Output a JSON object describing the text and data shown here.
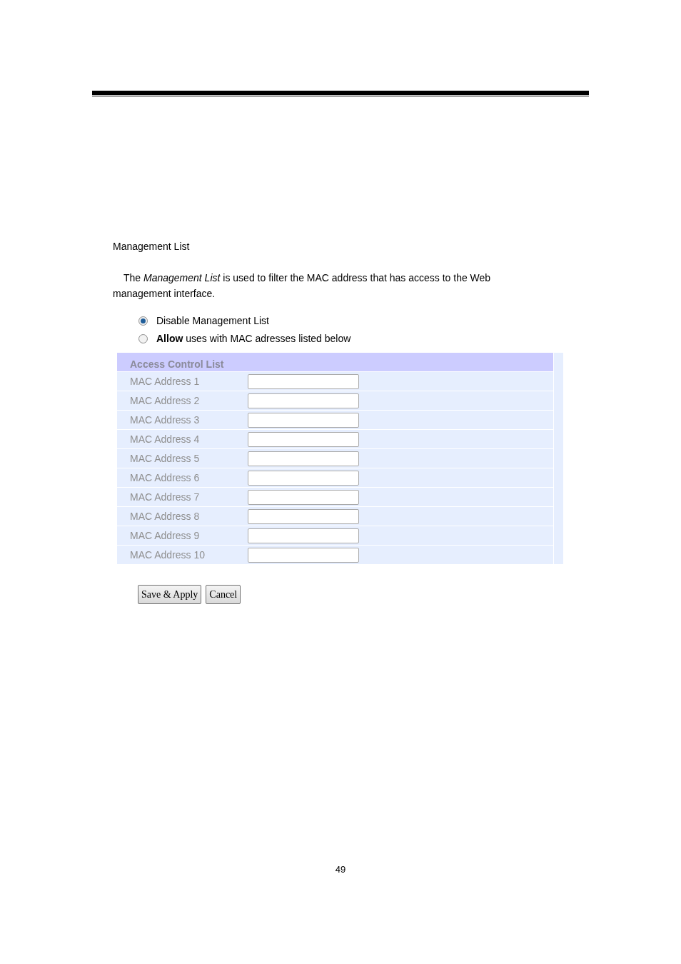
{
  "section_title": "Management List",
  "description": "The *Management List* is used to filter the MAC address that has access to the Web management interface.",
  "options": [
    {
      "label": "Disable Management List",
      "selected": true
    },
    {
      "label": "**Allow** uses with MAC adresses listed below",
      "selected": false
    }
  ],
  "table": {
    "title": "Access Control List",
    "rows": [
      {
        "label": "MAC Address 1"
      },
      {
        "label": "MAC Address 2"
      },
      {
        "label": "MAC Address 3"
      },
      {
        "label": "MAC Address 4"
      },
      {
        "label": "MAC Address 5"
      },
      {
        "label": "MAC Address 6"
      },
      {
        "label": "MAC Address 7"
      },
      {
        "label": "MAC Address 8"
      },
      {
        "label": "MAC Address 9"
      },
      {
        "label": "MAC Address 10"
      }
    ]
  },
  "buttons": [
    "Save & Apply",
    "Cancel"
  ],
  "page_number": "49"
}
